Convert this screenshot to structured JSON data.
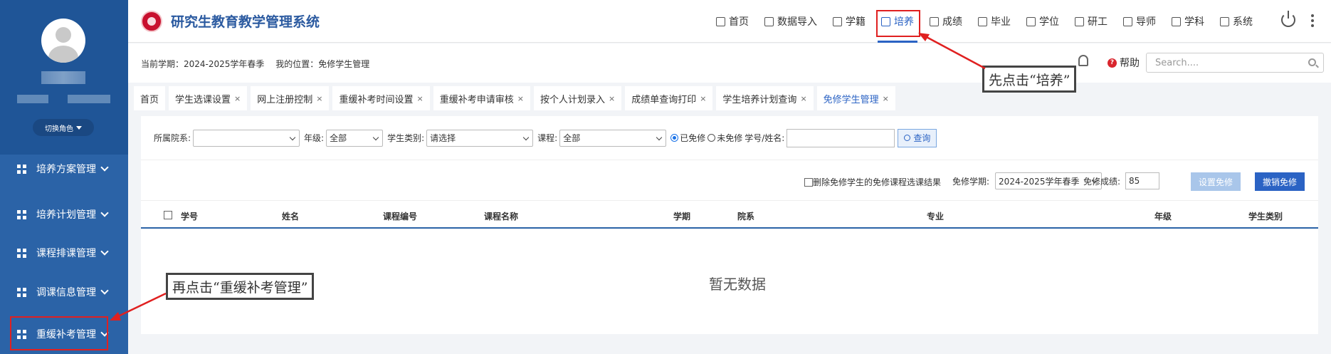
{
  "sidebar": {
    "role_button": "切换角色",
    "menu": [
      {
        "label": "培养方案管理"
      },
      {
        "label": "培养计划管理"
      },
      {
        "label": "课程排课管理"
      },
      {
        "label": "调课信息管理"
      },
      {
        "label": "重缓补考管理"
      }
    ]
  },
  "header": {
    "title": "研究生教育教学管理系统",
    "nav": [
      {
        "label": "首页",
        "icon": "home-icon"
      },
      {
        "label": "数据导入",
        "icon": "import-icon"
      },
      {
        "label": "学籍",
        "icon": "id-card-icon"
      },
      {
        "label": "培养",
        "icon": "chart-icon",
        "active": true
      },
      {
        "label": "成绩",
        "icon": "score-icon"
      },
      {
        "label": "毕业",
        "icon": "building-icon"
      },
      {
        "label": "学位",
        "icon": "graduation-icon"
      },
      {
        "label": "研工",
        "icon": "gear-icon"
      },
      {
        "label": "导师",
        "icon": "user-icon"
      },
      {
        "label": "学科",
        "icon": "bar-icon"
      },
      {
        "label": "系统",
        "icon": "settings-icon"
      }
    ]
  },
  "subheader": {
    "term": "当前学期：2024-2025学年春季",
    "location": "我的位置：免修学生管理",
    "help": "帮助",
    "search_placeholder": "Search...."
  },
  "tabs": [
    {
      "label": "首页",
      "closable": false
    },
    {
      "label": "学生选课设置",
      "closable": true
    },
    {
      "label": "网上注册控制",
      "closable": true
    },
    {
      "label": "重缓补考时间设置",
      "closable": true
    },
    {
      "label": "重缓补考申请审核",
      "closable": true
    },
    {
      "label": "按个人计划录入",
      "closable": true
    },
    {
      "label": "成绩单查询打印",
      "closable": true
    },
    {
      "label": "学生培养计划查询",
      "closable": true
    },
    {
      "label": "免修学生管理",
      "closable": true,
      "active": true
    }
  ],
  "filters": {
    "dept_label": "所属院系:",
    "dept_value": "",
    "grade_label": "年级:",
    "grade_value": "全部",
    "type_label": "学生类别:",
    "type_value": "请选择",
    "course_label": "课程:",
    "course_value": "全部",
    "radio_exempt": "已免修",
    "radio_not_exempt": "未免修",
    "id_label": "学号/姓名:",
    "query_button": "查询"
  },
  "actions": {
    "delete_check": "删除免修学生的免修课程选课结果",
    "term_label": "免修学期:",
    "term_value": "2024-2025学年春季",
    "score_label": "免修成绩:",
    "score_value": "85",
    "set_button": "设置免修",
    "cancel_button": "撤销免修"
  },
  "table": {
    "columns": [
      "学号",
      "姓名",
      "课程编号",
      "课程名称",
      "学期",
      "院系",
      "专业",
      "年级",
      "学生类别"
    ],
    "empty_text": "暂无数据"
  },
  "annotations": {
    "step1": "先点击“培养”",
    "step2": "再点击“重缓补考管理”",
    "highlight_color": "#e02020"
  }
}
